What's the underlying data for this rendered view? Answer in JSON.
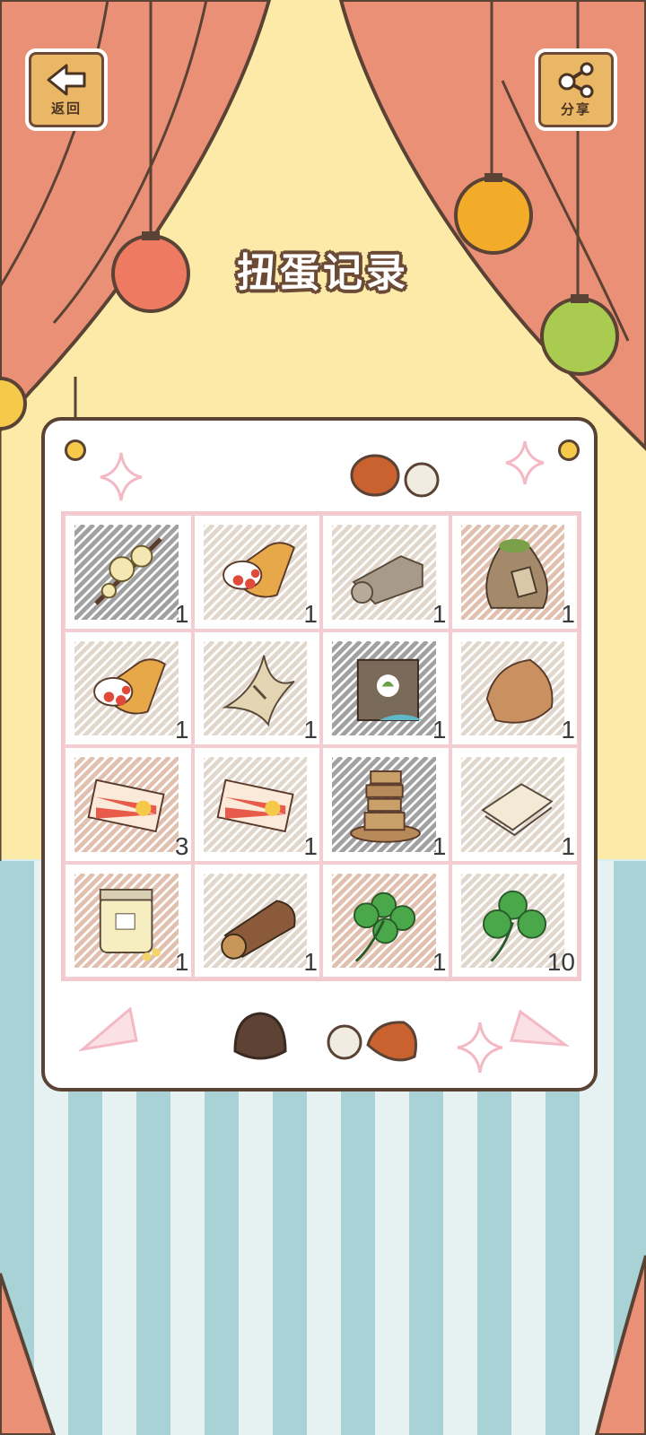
{
  "header": {
    "back_label": "返回",
    "share_label": "分享",
    "title": "扭蛋记录"
  },
  "colors": {
    "curtain": "#ea9077",
    "wall": "#fbeaa8",
    "board_border": "#5a4234",
    "grid_line": "#f4cdd3",
    "wood_button": "#e9b765"
  },
  "items": [
    {
      "name": "plum-blossom-branch",
      "count": "1",
      "scribble": "#555555"
    },
    {
      "name": "strawberry-crepe",
      "count": "1",
      "scribble": "#c9b8a6"
    },
    {
      "name": "rolled-cloth",
      "count": "1",
      "scribble": "#c9b8a6"
    },
    {
      "name": "seed-sack",
      "count": "1",
      "scribble": "#c98e6e"
    },
    {
      "name": "strawberry-crepe",
      "count": "1",
      "scribble": "#c9b8a6"
    },
    {
      "name": "dried-fish-bundle",
      "count": "1",
      "scribble": "#c9b8a6"
    },
    {
      "name": "seed-bag",
      "count": "1",
      "scribble": "#555555"
    },
    {
      "name": "wrapped-parcel",
      "count": "1",
      "scribble": "#c9b8a6"
    },
    {
      "name": "rising-sun-ticket",
      "count": "3",
      "scribble": "#c98e6e"
    },
    {
      "name": "rising-sun-ticket",
      "count": "1",
      "scribble": "#c9b8a6"
    },
    {
      "name": "stacked-wood-tower",
      "count": "1",
      "scribble": "#555555"
    },
    {
      "name": "paper-sheets",
      "count": "1",
      "scribble": "#c9b8a6"
    },
    {
      "name": "candy-jar",
      "count": "1",
      "scribble": "#c98e6e"
    },
    {
      "name": "wooden-log",
      "count": "1",
      "scribble": "#c9b8a6"
    },
    {
      "name": "four-leaf-clover",
      "count": "1",
      "scribble": "#c98e6e"
    },
    {
      "name": "three-leaf-clover",
      "count": "10",
      "scribble": "#c9b8a6"
    }
  ]
}
